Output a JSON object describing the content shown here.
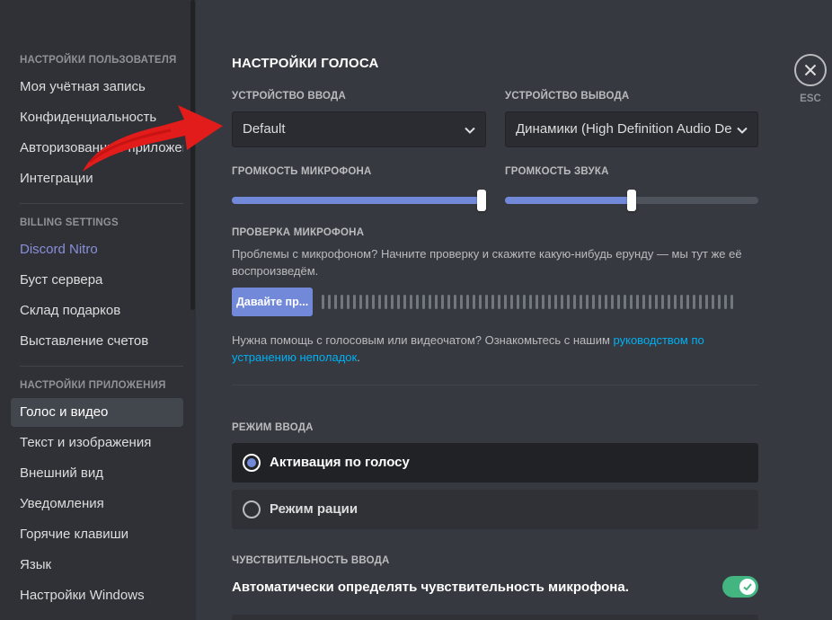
{
  "sidebar": {
    "sections": [
      {
        "header": "НАСТРОЙКИ ПОЛЬЗОВАТЕЛЯ",
        "items": [
          {
            "label": "Моя учётная запись"
          },
          {
            "label": "Конфиденциальность"
          },
          {
            "label": "Авторизованные приложения"
          },
          {
            "label": "Интеграции"
          }
        ]
      },
      {
        "header": "BILLING SETTINGS",
        "items": [
          {
            "label": "Discord Nitro"
          },
          {
            "label": "Буст сервера"
          },
          {
            "label": "Склад подарков"
          },
          {
            "label": "Выставление счетов"
          }
        ]
      },
      {
        "header": "НАСТРОЙКИ ПРИЛОЖЕНИЯ",
        "items": [
          {
            "label": "Голос и видео",
            "selected": true
          },
          {
            "label": "Текст и изображения"
          },
          {
            "label": "Внешний вид"
          },
          {
            "label": "Уведомления"
          },
          {
            "label": "Горячие клавиши"
          },
          {
            "label": "Язык"
          },
          {
            "label": "Настройки Windows"
          }
        ]
      }
    ]
  },
  "main": {
    "title": "НАСТРОЙКИ ГОЛОСА",
    "input_device": {
      "label": "УСТРОЙСТВО ВВОДА",
      "value": "Default",
      "icon": "chevron-down-icon"
    },
    "output_device": {
      "label": "УСТРОЙСТВО ВЫВОДА",
      "value": "Динамики (High Definition Audio De",
      "icon": "chevron-down-icon"
    },
    "mic_volume": {
      "label": "ГРОМКОСТЬ МИКРОФОНА",
      "value_fraction": 1.0
    },
    "output_volume": {
      "label": "ГРОМКОСТЬ ЗВУКА",
      "value_fraction": 0.5
    },
    "mic_test": {
      "label": "ПРОВЕРКА МИКРОФОНА",
      "description": "Проблемы с микрофоном? Начните проверку и скажите какую-нибудь ерунду — мы тут же её воспроизведём.",
      "button_label": "Давайте пр...",
      "meter_level": 0
    },
    "help": {
      "text": "Нужна помощь с голосовым или видеочатом? Ознакомьтесь с нашим ",
      "link_text": "руководством по устранению неполадок",
      "suffix": "."
    },
    "input_mode": {
      "label": "РЕЖИМ ВВОДА",
      "options": [
        {
          "label": "Активация по голосу",
          "selected": true
        },
        {
          "label": "Режим рации",
          "selected": false
        }
      ]
    },
    "sensitivity": {
      "label": "ЧУВСТВИТЕЛЬНОСТЬ ВВОДА",
      "auto_label": "Автоматически определять чувствительность микрофона.",
      "auto_enabled": true
    }
  },
  "close": {
    "label": "ESC",
    "icon": "close-icon"
  },
  "overlay": {
    "icon": "red-arrow-icon"
  },
  "colors": {
    "accent": "#7289da",
    "toggle_on": "#43b581",
    "link": "#00b0f4",
    "annotation_arrow": "#e21b1b"
  }
}
